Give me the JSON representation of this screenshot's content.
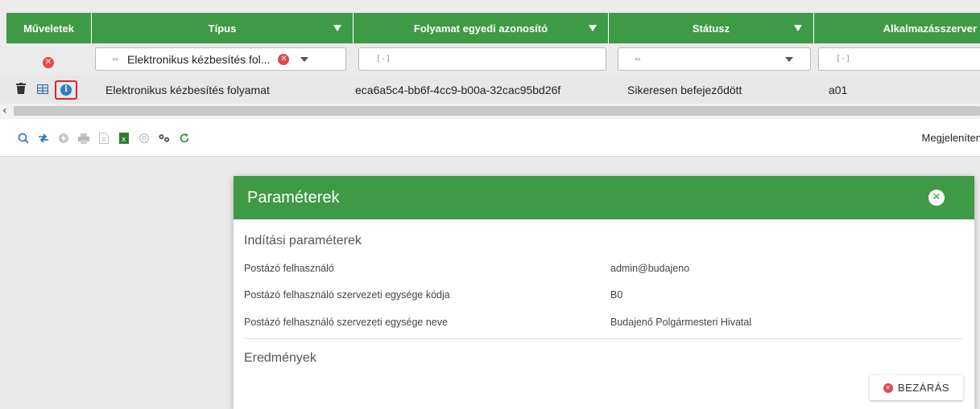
{
  "grid": {
    "columns": [
      {
        "label": "Műveletek"
      },
      {
        "label": "Típus"
      },
      {
        "label": "Folyamat egyedi azonosító"
      },
      {
        "label": "Státusz"
      },
      {
        "label": "Alkalmazásszerver"
      }
    ],
    "filters": {
      "tipus_value": "Elektronikus kézbesítés fol...",
      "azonosito_placeholder": "[-]",
      "allapot_placeholder": "",
      "szerver_placeholder": "[-]"
    },
    "row": {
      "tipus": "Elektronikus kézbesítés folyamat",
      "azonosito": "eca6a5c4-bb6f-4cc9-b00a-32cac95bd26f",
      "statusz": "Sikeresen befejeződött",
      "szerver": "a01"
    }
  },
  "toolbar": {
    "right_label": "Megjeleníten"
  },
  "modal": {
    "title": "Paraméterek",
    "start_section": "Indítási paraméterek",
    "params": [
      {
        "key": "Postázó felhasználó",
        "value": "admin@budajeno"
      },
      {
        "key": "Postázó felhasználó szervezeti egysége kódja",
        "value": "B0"
      },
      {
        "key": "Postázó felhasználó szervezeti egysége neve",
        "value": "Budajenő Polgármesteri Hivatal"
      }
    ],
    "results_section": "Eredmények",
    "close_button": "BEZÁRÁS"
  },
  "colors": {
    "header_green": "#3e9a44",
    "danger_red": "#e04b4b",
    "info_blue": "#2d7ec8",
    "highlight_red": "#e0232b"
  },
  "icons": {
    "toolbar": [
      "search-icon",
      "swap-icon",
      "add-icon",
      "print-icon",
      "document-icon",
      "excel-icon",
      "email-icon",
      "settings-icon",
      "refresh-icon"
    ]
  }
}
